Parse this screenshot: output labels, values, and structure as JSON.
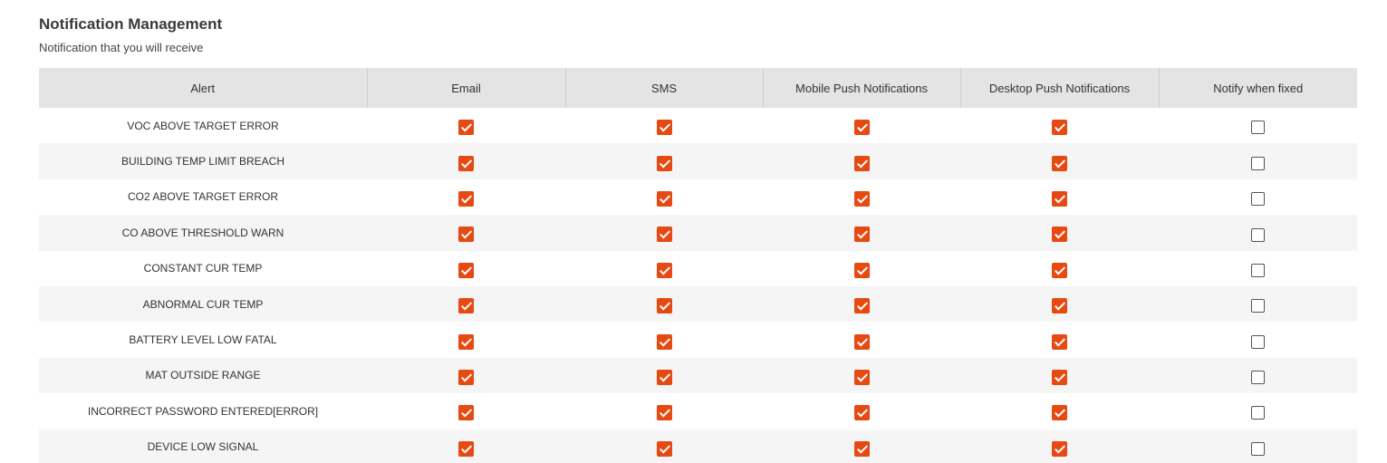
{
  "header": {
    "title": "Notification Management",
    "subtitle": "Notification that you will receive"
  },
  "table": {
    "columns": [
      "Alert",
      "Email",
      "SMS",
      "Mobile Push Notifications",
      "Desktop Push Notifications",
      "Notify when fixed"
    ],
    "rows": [
      {
        "alert": "VOC ABOVE TARGET ERROR",
        "email": true,
        "sms": true,
        "mobile_push": true,
        "desktop_push": true,
        "notify_fixed": false
      },
      {
        "alert": "BUILDING TEMP LIMIT BREACH",
        "email": true,
        "sms": true,
        "mobile_push": true,
        "desktop_push": true,
        "notify_fixed": false
      },
      {
        "alert": "CO2 ABOVE TARGET ERROR",
        "email": true,
        "sms": true,
        "mobile_push": true,
        "desktop_push": true,
        "notify_fixed": false
      },
      {
        "alert": "CO ABOVE THRESHOLD WARN",
        "email": true,
        "sms": true,
        "mobile_push": true,
        "desktop_push": true,
        "notify_fixed": false
      },
      {
        "alert": "CONSTANT CUR TEMP",
        "email": true,
        "sms": true,
        "mobile_push": true,
        "desktop_push": true,
        "notify_fixed": false
      },
      {
        "alert": "ABNORMAL CUR TEMP",
        "email": true,
        "sms": true,
        "mobile_push": true,
        "desktop_push": true,
        "notify_fixed": false
      },
      {
        "alert": "BATTERY LEVEL LOW FATAL",
        "email": true,
        "sms": true,
        "mobile_push": true,
        "desktop_push": true,
        "notify_fixed": false
      },
      {
        "alert": "MAT OUTSIDE RANGE",
        "email": true,
        "sms": true,
        "mobile_push": true,
        "desktop_push": true,
        "notify_fixed": false
      },
      {
        "alert": "INCORRECT PASSWORD ENTERED[ERROR]",
        "email": true,
        "sms": true,
        "mobile_push": true,
        "desktop_push": true,
        "notify_fixed": false
      },
      {
        "alert": "DEVICE LOW SIGNAL",
        "email": true,
        "sms": true,
        "mobile_push": true,
        "desktop_push": true,
        "notify_fixed": false
      }
    ]
  },
  "colors": {
    "checked": "#e64a12",
    "header_bg": "#e4e4e4",
    "stripe_bg": "#f5f5f5"
  }
}
